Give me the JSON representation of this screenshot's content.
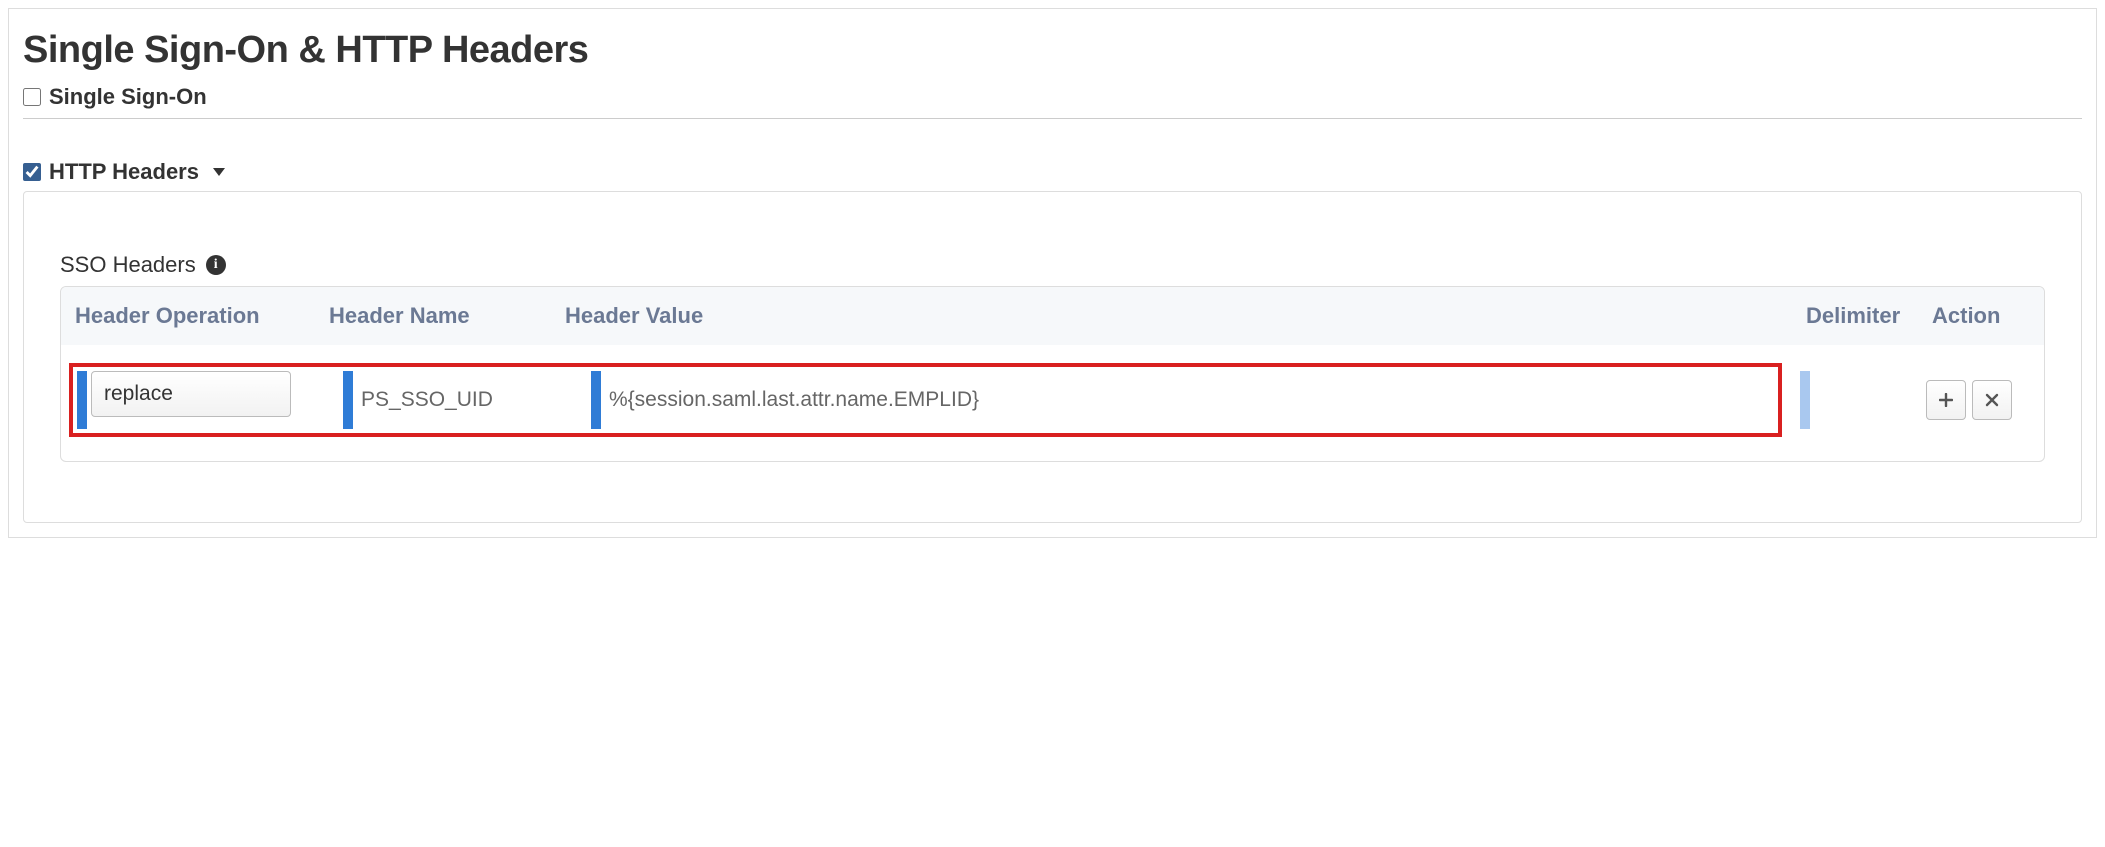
{
  "page": {
    "title": "Single Sign-On & HTTP Headers"
  },
  "single_sign_on": {
    "label": "Single Sign-On",
    "checked": false
  },
  "http_headers": {
    "label": "HTTP Headers",
    "checked": true,
    "expanded": true
  },
  "sso_headers": {
    "title": "SSO Headers",
    "columns": {
      "operation": "Header Operation",
      "name": "Header Name",
      "value": "Header Value",
      "delimiter": "Delimiter",
      "action": "Action"
    },
    "row": {
      "operation": "replace",
      "name": "PS_SSO_UID",
      "value": "%{session.saml.last.attr.name.EMPLID}",
      "delimiter": ""
    },
    "actions": {
      "add": "+",
      "remove": "✕"
    }
  }
}
